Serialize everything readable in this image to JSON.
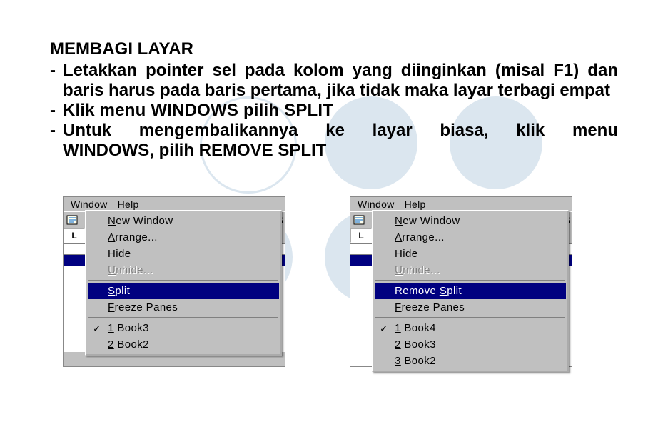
{
  "title": "MEMBAGI LAYAR",
  "bullets": [
    "Letakkan pointer sel pada kolom yang diinginkan (misal F1) dan baris harus pada baris pertama, jika tidak maka layar terbagi empat",
    "Klik menu WINDOWS pilih SPLIT",
    "Untuk mengembalikannya ke layar biasa, klik menu WINDOWS, pilih REMOVE SPLIT"
  ],
  "menubar": {
    "window": "Window",
    "help": "Help"
  },
  "toolbar_letter": "S",
  "namebox_letter": "L",
  "dropdown_left": {
    "new_window": "New Window",
    "arrange": "Arrange...",
    "hide": "Hide",
    "unhide": "Unhide...",
    "split": "Split",
    "freeze": "Freeze Panes",
    "book1": "1 Book3",
    "book2": "2 Book2"
  },
  "dropdown_right": {
    "new_window": "New Window",
    "arrange": "Arrange...",
    "hide": "Hide",
    "unhide": "Unhide...",
    "remove_split": "Remove Split",
    "freeze": "Freeze Panes",
    "book1": "1 Book4",
    "book2": "2 Book3",
    "book3": "3 Book2"
  }
}
